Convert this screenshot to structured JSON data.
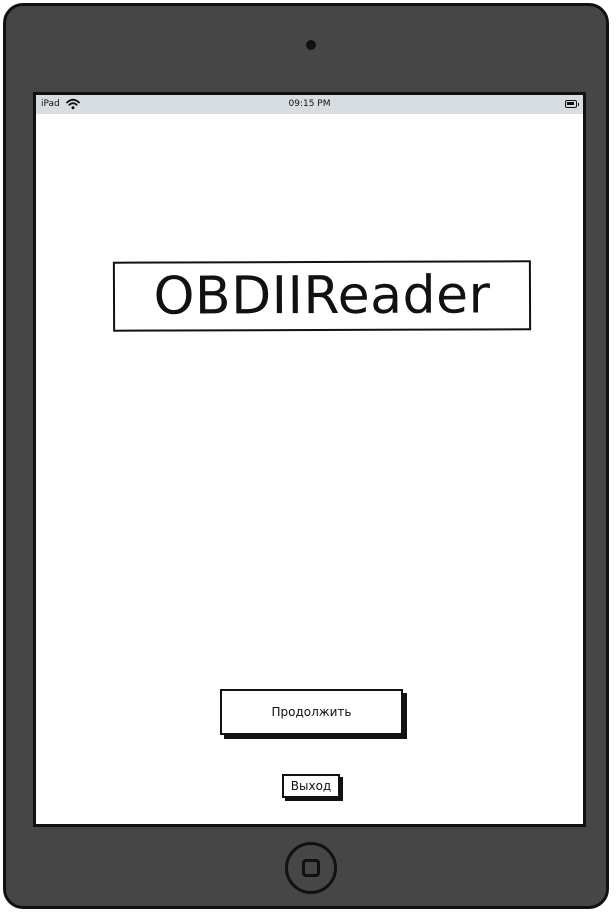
{
  "status_bar": {
    "carrier": "iPad",
    "time": "09:15 PM",
    "wifi_icon": "wifi-icon",
    "battery_icon": "battery-icon"
  },
  "main": {
    "app_title": "OBDIIReader",
    "continue_label": "Продолжить",
    "exit_label": "Выход"
  },
  "device": {
    "frame_color": "#464646",
    "screen_color": "#ffffff",
    "status_bar_color": "#d7dde1",
    "camera_icon": "camera-icon",
    "home_icon": "home-button-icon"
  }
}
